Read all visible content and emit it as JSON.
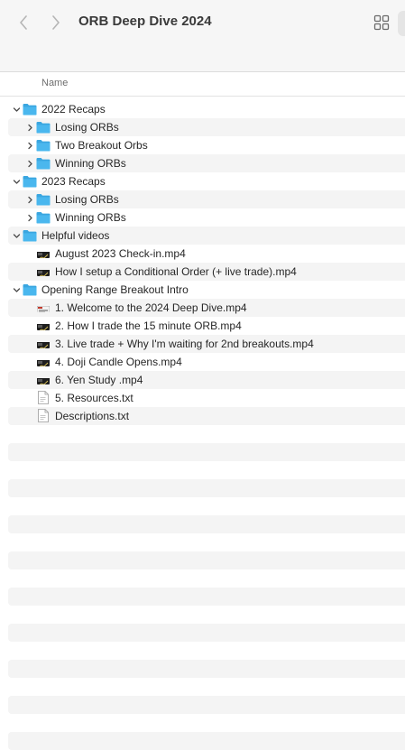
{
  "window": {
    "title": "ORB Deep Dive 2024"
  },
  "toolbar": {
    "back_icon": "chevron-left-icon",
    "forward_icon": "chevron-right-icon",
    "view_icon": "grid-view-icon"
  },
  "columns": {
    "name": "Name"
  },
  "colors": {
    "folder": "#4ab7ee",
    "folder_tab": "#3aa6e0",
    "alt_row": "#f4f4f4",
    "toolbar_bg": "#f6f6f6"
  },
  "rows": [
    {
      "label": "2022 Recaps",
      "kind": "folder",
      "level": 0,
      "expanded": true
    },
    {
      "label": "Losing ORBs",
      "kind": "folder",
      "level": 1,
      "expanded": false
    },
    {
      "label": "Two Breakout Orbs",
      "kind": "folder",
      "level": 1,
      "expanded": false
    },
    {
      "label": "Winning ORBs",
      "kind": "folder",
      "level": 1,
      "expanded": false
    },
    {
      "label": "2023 Recaps",
      "kind": "folder",
      "level": 0,
      "expanded": true
    },
    {
      "label": "Losing ORBs",
      "kind": "folder",
      "level": 1,
      "expanded": false
    },
    {
      "label": "Winning ORBs",
      "kind": "folder",
      "level": 1,
      "expanded": false
    },
    {
      "label": "Helpful videos",
      "kind": "folder",
      "level": 0,
      "expanded": true
    },
    {
      "label": "August 2023 Check-in.mp4",
      "kind": "video",
      "level": 1,
      "thumb": "dark"
    },
    {
      "label": "How I setup a Conditional Order (+ live trade).mp4",
      "kind": "video",
      "level": 1,
      "thumb": "dark"
    },
    {
      "label": "Opening Range Breakout Intro",
      "kind": "folder",
      "level": 0,
      "expanded": true
    },
    {
      "label": "1. Welcome to the 2024 Deep Dive.mp4",
      "kind": "video",
      "level": 1,
      "thumb": "light"
    },
    {
      "label": "2. How I trade the 15 minute ORB.mp4",
      "kind": "video",
      "level": 1,
      "thumb": "dark"
    },
    {
      "label": "3. Live trade + Why I'm waiting for 2nd breakouts.mp4",
      "kind": "video",
      "level": 1,
      "thumb": "dark"
    },
    {
      "label": "4. Doji Candle Opens.mp4",
      "kind": "video",
      "level": 1,
      "thumb": "dark"
    },
    {
      "label": "6. Yen Study .mp4",
      "kind": "video",
      "level": 1,
      "thumb": "dark"
    },
    {
      "label": "5. Resources.txt",
      "kind": "text",
      "level": 1
    },
    {
      "label": "Descriptions.txt",
      "kind": "text",
      "level": 1
    },
    {
      "label": "",
      "kind": "empty",
      "level": 0
    },
    {
      "label": "",
      "kind": "empty",
      "level": 0
    },
    {
      "label": "",
      "kind": "empty",
      "level": 0
    },
    {
      "label": "",
      "kind": "empty",
      "level": 0
    },
    {
      "label": "",
      "kind": "empty",
      "level": 0
    },
    {
      "label": "",
      "kind": "empty",
      "level": 0
    },
    {
      "label": "",
      "kind": "empty",
      "level": 0
    },
    {
      "label": "",
      "kind": "empty",
      "level": 0
    },
    {
      "label": "",
      "kind": "empty",
      "level": 0
    },
    {
      "label": "",
      "kind": "empty",
      "level": 0
    },
    {
      "label": "",
      "kind": "empty",
      "level": 0
    },
    {
      "label": "",
      "kind": "empty",
      "level": 0
    },
    {
      "label": "",
      "kind": "empty",
      "level": 0
    },
    {
      "label": "",
      "kind": "empty",
      "level": 0
    },
    {
      "label": "",
      "kind": "empty",
      "level": 0
    },
    {
      "label": "",
      "kind": "empty",
      "level": 0
    },
    {
      "label": "",
      "kind": "empty",
      "level": 0
    },
    {
      "label": "",
      "kind": "empty",
      "level": 0
    }
  ]
}
